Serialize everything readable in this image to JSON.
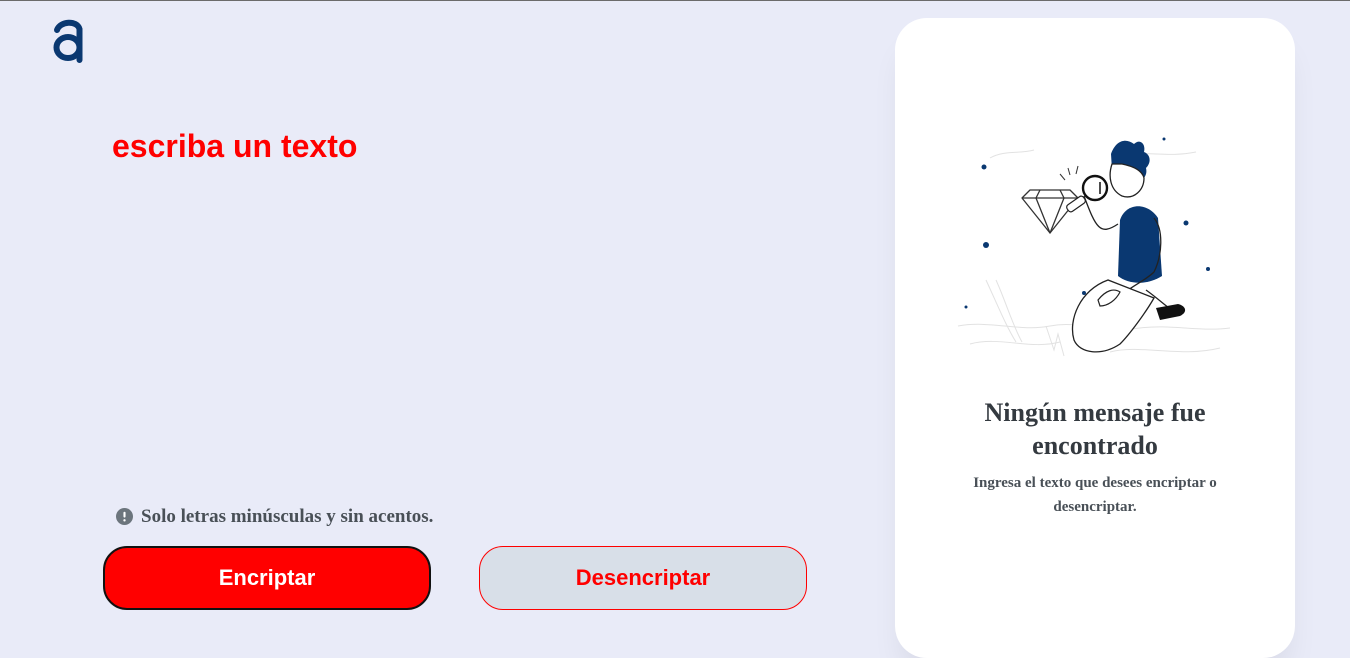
{
  "brand": {
    "logo_icon": "alura-a-logo-icon",
    "logo_color": "#0A3871"
  },
  "editor": {
    "placeholder": "escriba un texto",
    "value": ""
  },
  "hint": {
    "icon": "exclamation-circle-icon",
    "text": "Solo letras minúsculas y sin acentos."
  },
  "actions": {
    "encrypt_label": "Encriptar",
    "decrypt_label": "Desencriptar"
  },
  "output_panel": {
    "illustration": "person-searching-with-magnifying-glass-illustration",
    "title": "Ningún mensaje fue encontrado",
    "subtitle": "Ingresa el texto que desees encriptar o desencriptar."
  },
  "colors": {
    "background": "#E9EBF8",
    "accent": "#FF0000",
    "dark_blue": "#0A3871",
    "panel": "#FFFFFF",
    "secondary_button": "#D8DFE8"
  }
}
